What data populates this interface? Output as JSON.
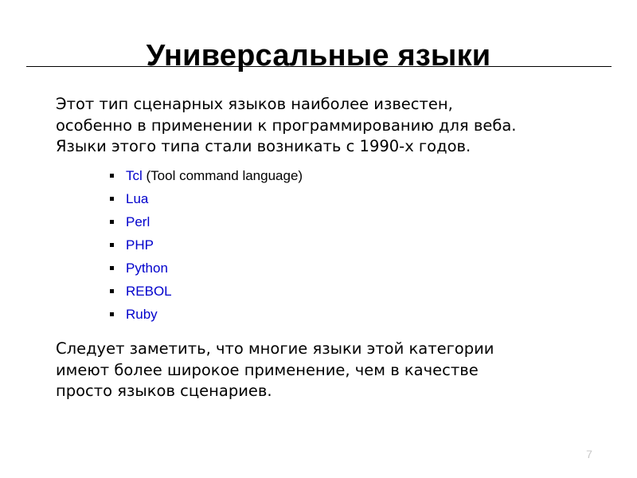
{
  "slide": {
    "title": "Универсальные языки",
    "page_number": "7",
    "colors": {
      "link": "#0000CC",
      "text": "#000000",
      "background": "#FFFFFF",
      "page_number": "#C8C8C8",
      "rule": "#000000"
    },
    "intro_paragraph": {
      "lines": [
        "Этот тип сценарных языков наиболее известен,",
        "особенно в применении к программированию для веба.",
        "Языки этого типа стали возникать с 1990-х годов."
      ]
    },
    "languages": [
      {
        "name": "Tcl",
        "note": " (Tool command language)"
      },
      {
        "name": "Lua",
        "note": ""
      },
      {
        "name": "Perl",
        "note": ""
      },
      {
        "name": "PHP",
        "note": ""
      },
      {
        "name": "Python",
        "note": ""
      },
      {
        "name": "REBOL",
        "note": ""
      },
      {
        "name": "Ruby",
        "note": ""
      }
    ],
    "closing_paragraph": {
      "lines": [
        "Следует заметить, что многие языки этой категории",
        "имеют более широкое применение, чем в качестве",
        "просто языков сценариев."
      ]
    }
  }
}
